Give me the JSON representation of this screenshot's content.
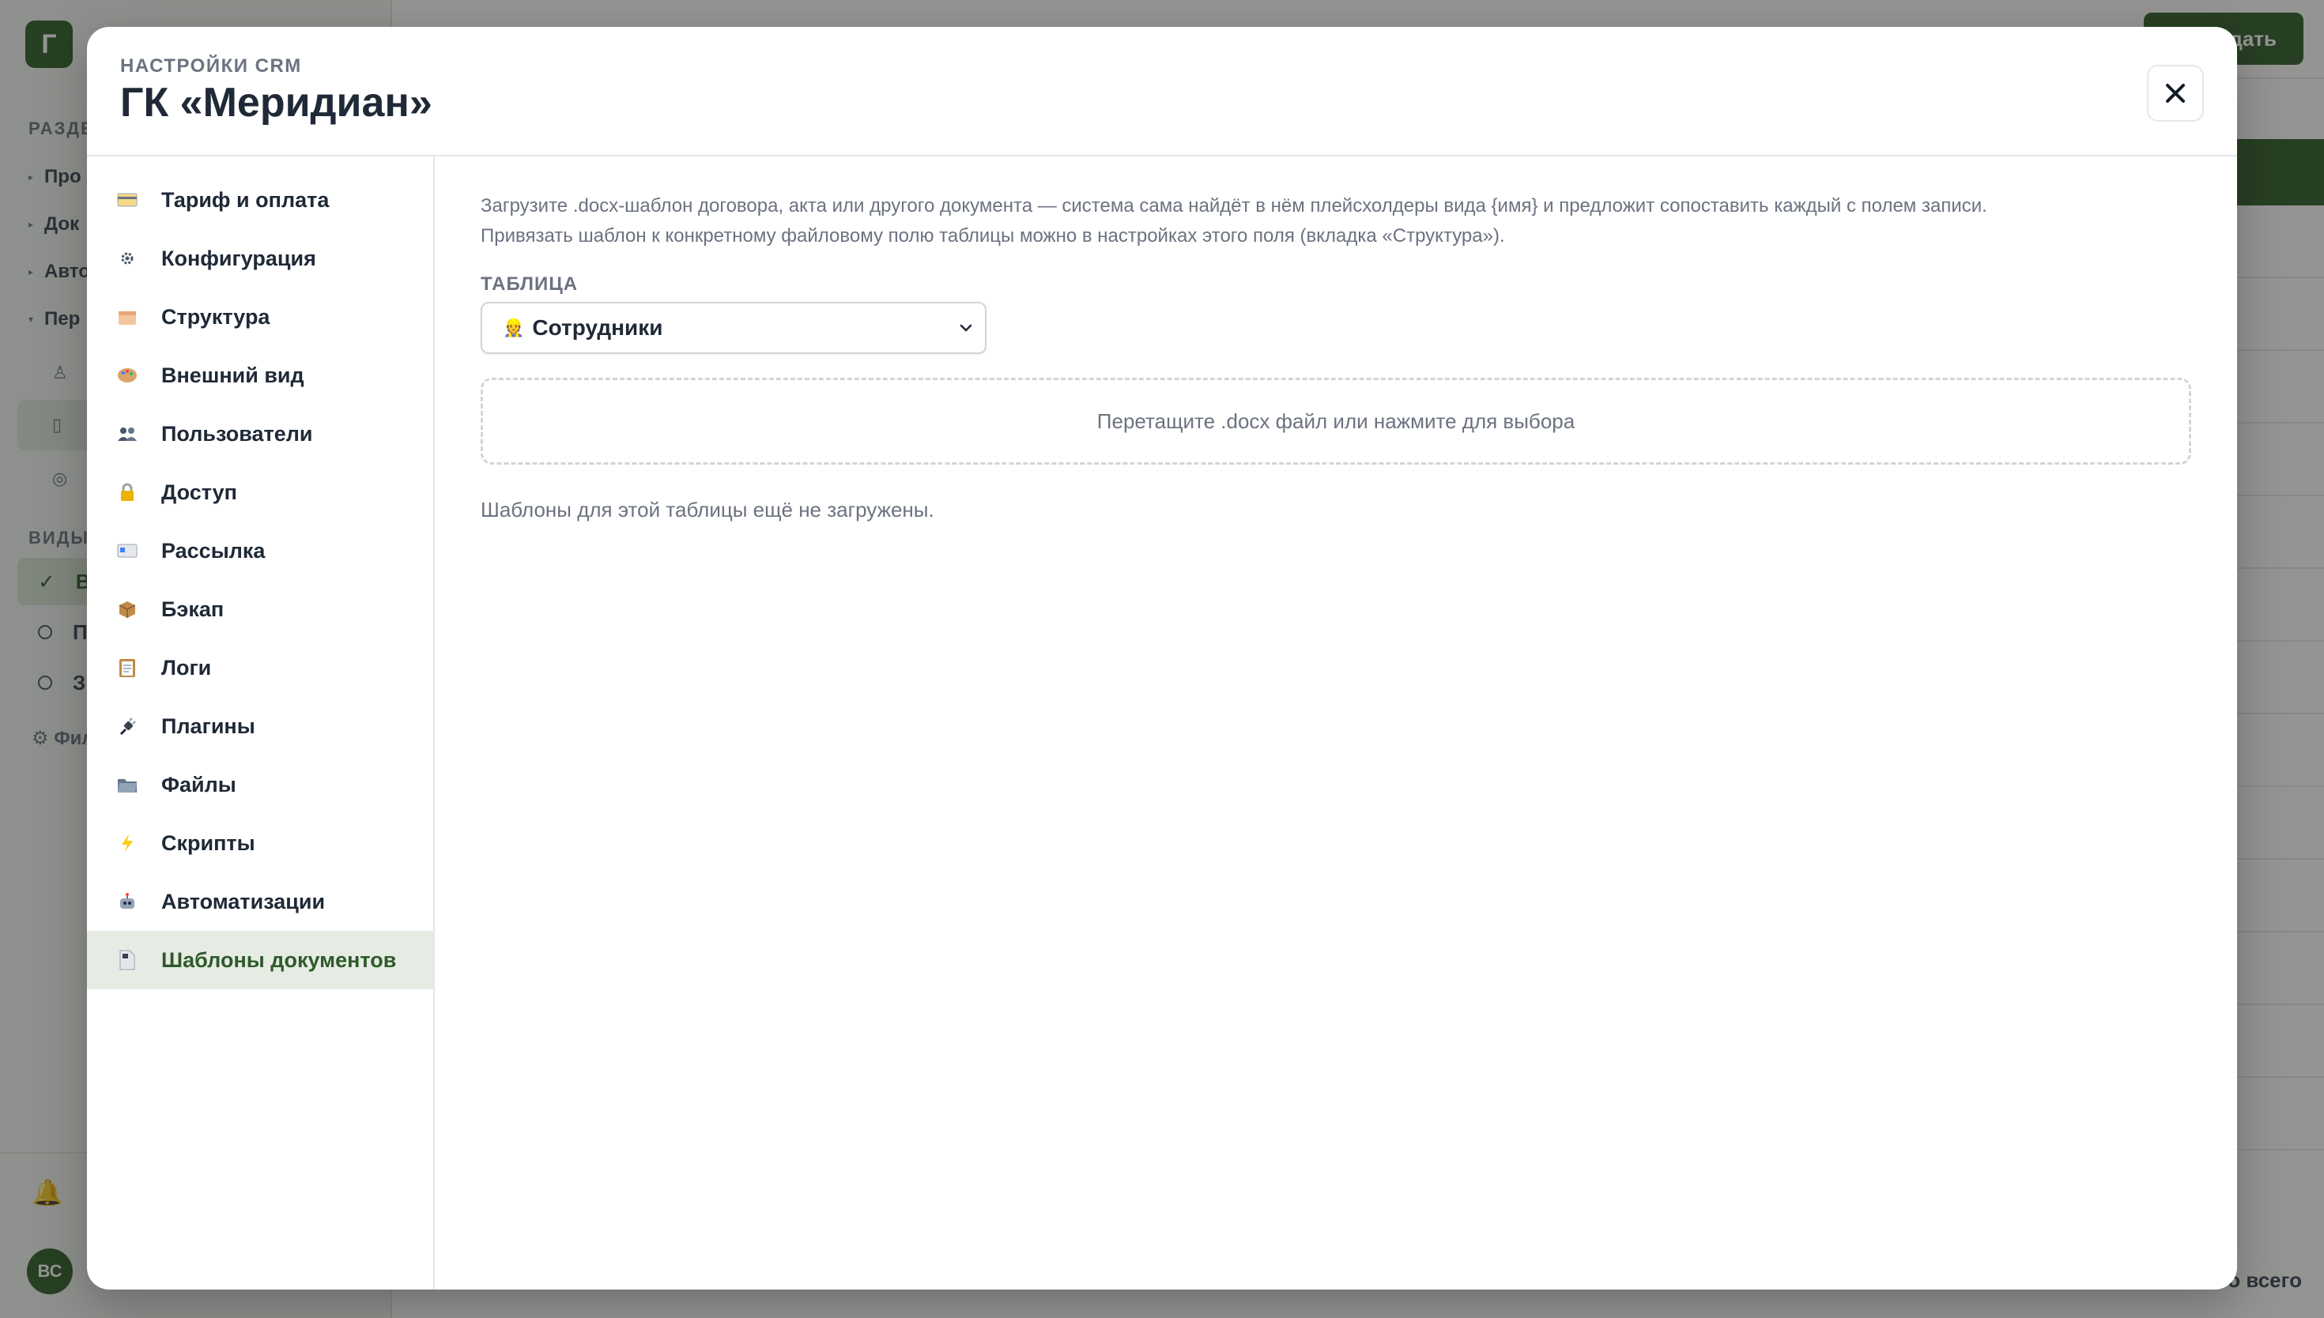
{
  "background": {
    "logo_letter": "Г",
    "section_label": "РАЗДЕ",
    "nav": [
      {
        "label": "Про"
      },
      {
        "label": "Док"
      },
      {
        "label": "Авто"
      },
      {
        "label": "Пер"
      }
    ],
    "views_label": "ВИДЫ",
    "views": [
      {
        "label": "В",
        "selected": true
      },
      {
        "label": "П",
        "selected": false
      },
      {
        "label": "З",
        "selected": false
      }
    ],
    "filter_label": "Фил",
    "avatar_initials": "ВС",
    "create_button": "дать",
    "total_text": "о всего"
  },
  "modal": {
    "kicker": "НАСТРОЙКИ CRM",
    "title": "ГК «Меридиан»",
    "close_icon": "close-icon",
    "nav_items": [
      {
        "label": "Тариф и оплата",
        "icon": "credit-card-icon",
        "active": false
      },
      {
        "label": "Конфигурация",
        "icon": "gear-icon",
        "active": false
      },
      {
        "label": "Структура",
        "icon": "boxes-icon",
        "active": false
      },
      {
        "label": "Внешний вид",
        "icon": "palette-icon",
        "active": false
      },
      {
        "label": "Пользователи",
        "icon": "users-icon",
        "active": false
      },
      {
        "label": "Доступ",
        "icon": "lock-icon",
        "active": false
      },
      {
        "label": "Рассылка",
        "icon": "mail-icon",
        "active": false
      },
      {
        "label": "Бэкап",
        "icon": "package-icon",
        "active": false
      },
      {
        "label": "Логи",
        "icon": "clipboard-icon",
        "active": false
      },
      {
        "label": "Плагины",
        "icon": "plug-icon",
        "active": false
      },
      {
        "label": "Файлы",
        "icon": "folder-icon",
        "active": false
      },
      {
        "label": "Скрипты",
        "icon": "lightning-icon",
        "active": false
      },
      {
        "label": "Автоматизации",
        "icon": "robot-icon",
        "active": false
      },
      {
        "label": "Шаблоны документов",
        "icon": "document-icon",
        "active": true
      }
    ],
    "content": {
      "description_line1": "Загрузите .docx-шаблон договора, акта или другого документа — система сама найдёт в нём плейсхолдеры вида {имя} и предложит сопоставить каждый с полем записи.",
      "description_line2": "Привязать шаблон к конкретному файловому полю таблицы можно в настройках этого поля (вкладка «Структура»).",
      "table_label": "ТАБЛИЦА",
      "table_select": {
        "emoji": "👷",
        "value": "Сотрудники"
      },
      "dropzone_text": "Перетащите .docx файл или нажмите для выбора",
      "empty_message": "Шаблоны для этой таблицы ещё не загружены."
    }
  },
  "colors": {
    "accent": "#2f5a2a",
    "active_nav_bg": "#e6ebe4",
    "muted_text": "#6b7280"
  }
}
